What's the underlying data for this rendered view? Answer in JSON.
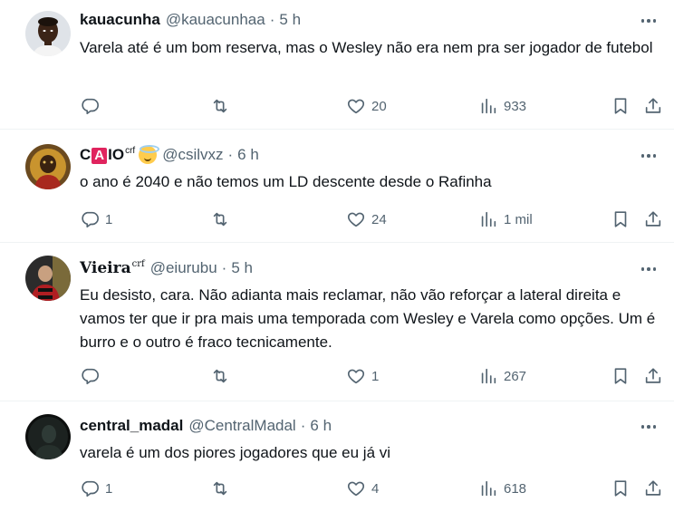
{
  "tweets": [
    {
      "name": "kauacunha",
      "handle": "@kauacunhaa",
      "dot": "·",
      "time": "5 h",
      "text": "Varela até é um bom reserva, mas o Wesley não era nem pra ser jogador de futebol",
      "replies": "",
      "retweets": "",
      "likes": "20",
      "views": "933"
    },
    {
      "name_part1": "C",
      "name_badge": "A",
      "name_part2": "IO",
      "name_sup": "crf",
      "handle": "@csilvxz",
      "dot": "·",
      "time": "6 h",
      "text": "o ano é 2040 e não temos um LD descente desde o Rafinha",
      "replies": "1",
      "retweets": "",
      "likes": "24",
      "views": "1 mil"
    },
    {
      "name": "Vieira",
      "name_sup": "crf",
      "handle": "@eiurubu",
      "dot": "·",
      "time": "5 h",
      "text": "Eu desisto, cara. Não adianta mais reclamar, não vão reforçar a lateral direita e vamos ter que ir pra mais uma temporada com Wesley e Varela como opções. Um é burro e o outro é fraco tecnicamente.",
      "replies": "",
      "retweets": "",
      "likes": "1",
      "views": "267"
    },
    {
      "name": "central_madal",
      "handle": "@CentralMadal",
      "dot": "·",
      "time": "6 h",
      "text": "varela é um dos piores jogadores que eu já vi",
      "replies": "1",
      "retweets": "",
      "likes": "4",
      "views": "618"
    }
  ],
  "icons": {
    "reply": "reply-icon",
    "retweet": "retweet-icon",
    "like": "heart-icon",
    "views": "views-icon",
    "bookmark": "bookmark-icon",
    "share": "share-icon",
    "more": "more-icon"
  },
  "colors": {
    "text": "#0f1419",
    "secondary": "#536471",
    "divider": "#eff3f4",
    "badge": "#e0245e"
  }
}
